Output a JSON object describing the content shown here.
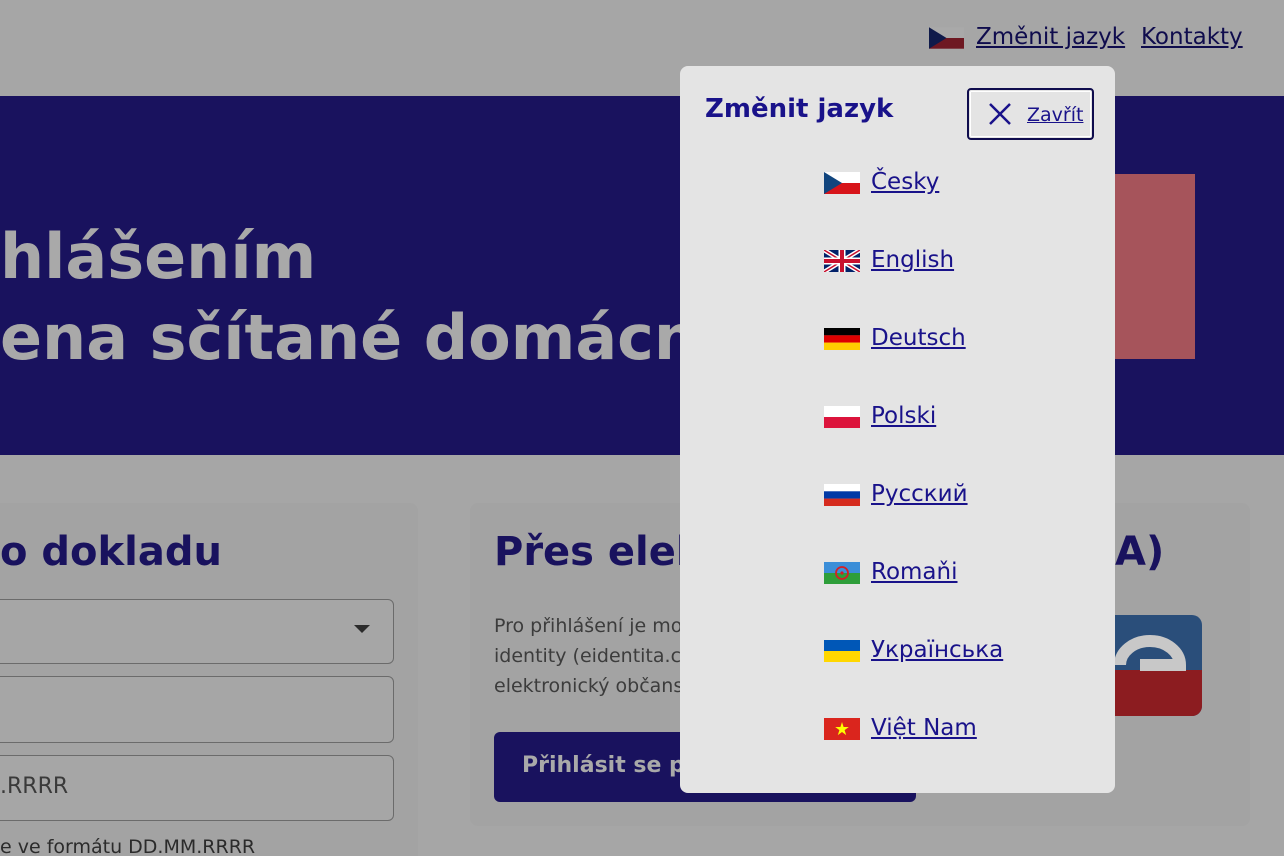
{
  "header": {
    "change_language": "Změnit jazyk",
    "contacts": "Kontakty"
  },
  "hero": {
    "line1": "hlášením",
    "line2": "ena sčítané domácnos"
  },
  "left_card": {
    "title": "o dokladu",
    "date_placeholder": ".RRRR",
    "hint": "e ve formátu DD.MM.RRRR"
  },
  "mid_card": {
    "title": "Přes elek",
    "title_tail": "A)",
    "text_line1": "Pro přihlášení je mo",
    "text_line2": "identity (eidentita.cz",
    "text_line3": "elektronický občans",
    "button": "Přihlásit se pře"
  },
  "modal": {
    "title": "Změnit jazyk",
    "close_label": "Zavřít",
    "languages": [
      {
        "label": "Česky",
        "flag": "flag-cz"
      },
      {
        "label": "English",
        "flag": "flag-gb"
      },
      {
        "label": "Deutsch",
        "flag": "flag-de"
      },
      {
        "label": "Polski",
        "flag": "flag-pl"
      },
      {
        "label": "Русский",
        "flag": "flag-ru"
      },
      {
        "label": "Romaňi",
        "flag": "flag-roma"
      },
      {
        "label": "Українська",
        "flag": "flag-ua"
      },
      {
        "label": "Việt Nam",
        "flag": "flag-vn"
      }
    ]
  },
  "colors": {
    "brand_navy": "#19125e",
    "link": "#19128a",
    "modal_bg": "#e4e4e4",
    "overlay": "#a6a6a6"
  }
}
